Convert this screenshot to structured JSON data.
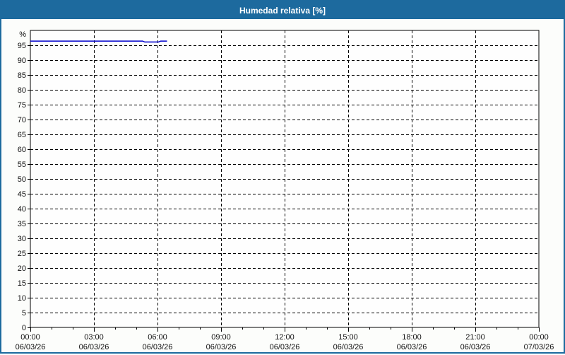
{
  "header": {
    "title": "Humedad relativa [%]"
  },
  "colors": {
    "frame": "#1d6a9e",
    "header_bg": "#1d6a9e",
    "title_text": "#ffffff",
    "page_bg": "#fcfdfb",
    "plot_bg": "#fefefe",
    "grid": "#000000",
    "axis_text": "#101010",
    "line": "#0000cc"
  },
  "chart_data": {
    "type": "line",
    "title": "Humedad relativa [%]",
    "ylabel": "%",
    "xlabel": "",
    "ylim": [
      0,
      100
    ],
    "ytick_step": 5,
    "yticks": [
      0,
      5,
      10,
      15,
      20,
      25,
      30,
      35,
      40,
      45,
      50,
      55,
      60,
      65,
      70,
      75,
      80,
      85,
      90,
      95
    ],
    "xlim_hours": [
      0,
      24
    ],
    "minor_xtick_every_hours": 1,
    "major_xtick_every_hours": 3,
    "grid": {
      "style": "dashed",
      "color": "#000000",
      "horizontal_every": 5,
      "vertical_every_hours": 3
    },
    "legend": "none",
    "xticks": [
      {
        "hour": 0,
        "time": "00:00",
        "date": "06/03/26"
      },
      {
        "hour": 3,
        "time": "03:00",
        "date": "06/03/26"
      },
      {
        "hour": 6,
        "time": "06:00",
        "date": "06/03/26"
      },
      {
        "hour": 9,
        "time": "09:00",
        "date": "06/03/26"
      },
      {
        "hour": 12,
        "time": "12:00",
        "date": "06/03/26"
      },
      {
        "hour": 15,
        "time": "15:00",
        "date": "06/03/26"
      },
      {
        "hour": 18,
        "time": "18:00",
        "date": "06/03/26"
      },
      {
        "hour": 21,
        "time": "21:00",
        "date": "06/03/26"
      },
      {
        "hour": 24,
        "time": "00:00",
        "date": "07/03/26"
      }
    ],
    "series": [
      {
        "name": "humedad-relativa",
        "color": "#0000cc",
        "points_hours_value": [
          [
            0.0,
            96.4
          ],
          [
            5.3,
            96.4
          ],
          [
            5.4,
            96.1
          ],
          [
            6.05,
            96.1
          ],
          [
            6.15,
            96.4
          ],
          [
            6.45,
            96.4
          ]
        ]
      }
    ]
  }
}
